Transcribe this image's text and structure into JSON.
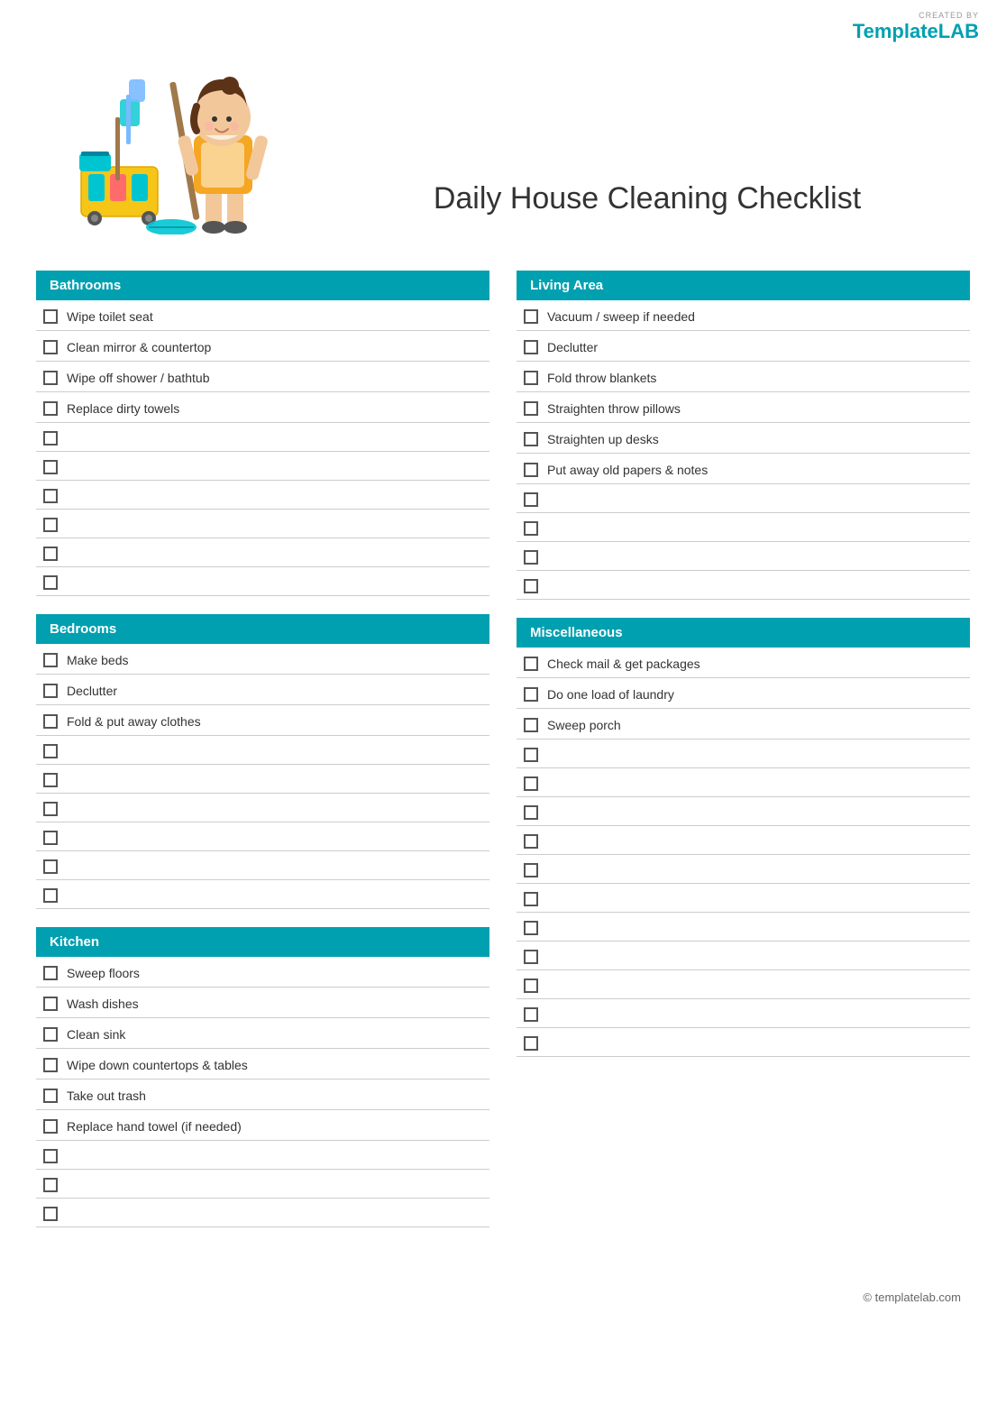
{
  "logo": {
    "created_by": "CREATED BY",
    "brand_template": "Template",
    "brand_lab": "LAB"
  },
  "hero": {
    "title": "Daily House Cleaning Checklist"
  },
  "sections": {
    "bathrooms": {
      "header": "Bathrooms",
      "items": [
        "Wipe toilet seat",
        "Clean mirror & countertop",
        "Wipe off shower / bathtub",
        "Replace dirty towels",
        "",
        "",
        "",
        "",
        "",
        ""
      ]
    },
    "bedrooms": {
      "header": "Bedrooms",
      "items": [
        "Make beds",
        "Declutter",
        "Fold & put away clothes",
        "",
        "",
        "",
        "",
        "",
        ""
      ]
    },
    "kitchen": {
      "header": "Kitchen",
      "items": [
        "Sweep floors",
        "Wash dishes",
        "Clean sink",
        "Wipe down countertops & tables",
        "Take out trash",
        "Replace hand towel (if needed)",
        "",
        "",
        ""
      ]
    },
    "living_area": {
      "header": "Living Area",
      "items": [
        "Vacuum / sweep if needed",
        "Declutter",
        "Fold throw blankets",
        "Straighten throw pillows",
        "Straighten up desks",
        "Put away old papers & notes",
        "",
        "",
        "",
        ""
      ]
    },
    "miscellaneous": {
      "header": "Miscellaneous",
      "items": [
        "Check mail & get packages",
        "Do one load of laundry",
        "Sweep porch",
        "",
        "",
        "",
        "",
        "",
        "",
        "",
        "",
        "",
        "",
        ""
      ]
    }
  },
  "footer": {
    "text": "© templatelab.com"
  }
}
